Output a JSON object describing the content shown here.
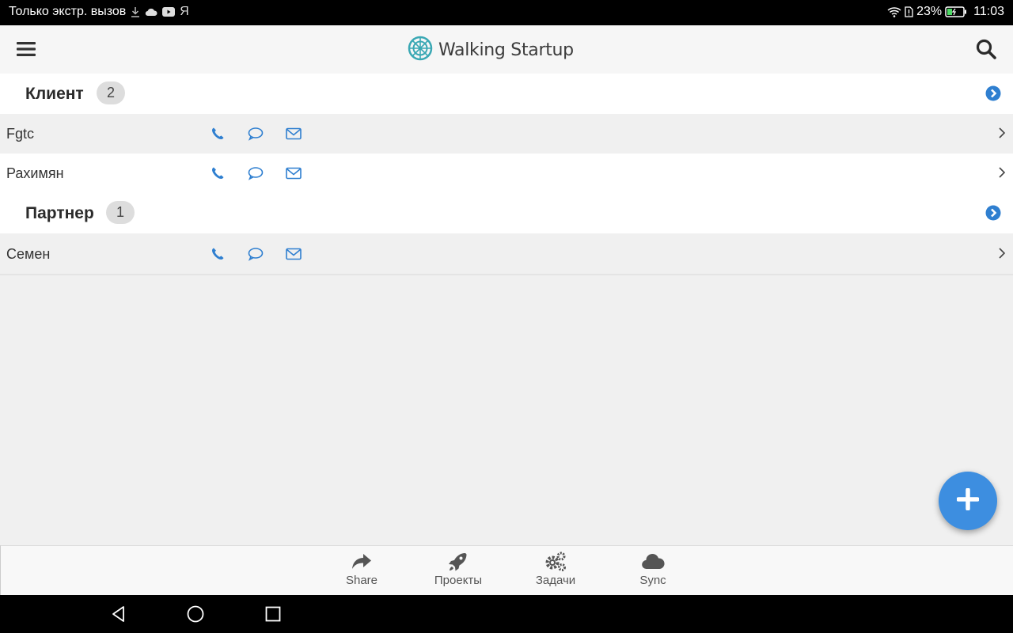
{
  "status_bar": {
    "carrier_text": "Только экстр. вызов",
    "ya_text": "Я",
    "battery_percent": "23%",
    "time": "11:03"
  },
  "header": {
    "app_title": "Walking Startup",
    "logo_color": "#3aa8b4"
  },
  "groups": [
    {
      "title": "Клиент",
      "count": "2",
      "contacts": [
        {
          "name": "Fgtc"
        },
        {
          "name": "Рахимян"
        }
      ]
    },
    {
      "title": "Партнер",
      "count": "1",
      "contacts": [
        {
          "name": "Семен"
        }
      ]
    }
  ],
  "tabs": [
    {
      "label": "Share",
      "icon": "share-icon"
    },
    {
      "label": "Проекты",
      "icon": "rocket-icon"
    },
    {
      "label": "Задачи",
      "icon": "gears-icon"
    },
    {
      "label": "Sync",
      "icon": "cloud-icon"
    }
  ],
  "colors": {
    "accent": "#2f7fd0",
    "fab": "#3d8ee0",
    "action_icon": "#2f7fd0"
  },
  "fab": {
    "icon": "plus-icon"
  }
}
